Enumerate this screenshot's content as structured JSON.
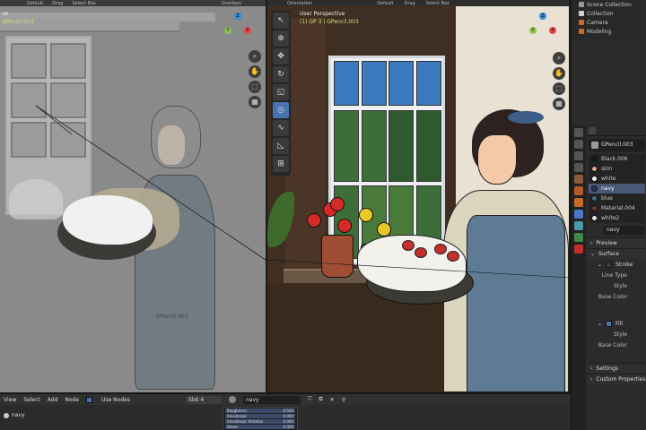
{
  "left_viewport": {
    "header_items": [
      "Default",
      "Drag",
      "Select Box",
      "Overlays"
    ],
    "title": "ve",
    "subtitle": "GPencil.003",
    "object_label": "GPencil.003"
  },
  "right_viewport": {
    "header_items": [
      "Orientation",
      "Default",
      "Drag",
      "Select Box"
    ],
    "title": "User Perspective",
    "subtitle": "(1) GP 3 | GPencil.003"
  },
  "gizmo": {
    "x": "X",
    "y": "Y",
    "z": "Z"
  },
  "outliner": {
    "items": [
      {
        "label": "Scene Collection",
        "color": "#9a9a9a"
      },
      {
        "label": "Collection",
        "color": "#d0d0d0"
      },
      {
        "label": "Camera",
        "color": "#c46a2a"
      },
      {
        "label": "Modeling",
        "color": "#c46a2a"
      }
    ]
  },
  "properties": {
    "object_name": "GPencil.003",
    "materials": [
      {
        "label": "Black.006",
        "color": "#1b1b1b"
      },
      {
        "label": "skin",
        "color": "#e6a77e"
      },
      {
        "label": "white",
        "color": "#f2f2f2"
      },
      {
        "label": "navy",
        "color": "#2b3a5a",
        "selected": true
      },
      {
        "label": "blue",
        "color": "#4a6a8a"
      },
      {
        "label": "Material.004",
        "color": "#6b3a2a"
      },
      {
        "label": "white2",
        "color": "#e8e8e8"
      }
    ],
    "active_material": "navy",
    "sections": {
      "preview": "Preview",
      "surface": "Surface",
      "stroke": "Stroke",
      "line_type": "Line Type",
      "style": "Style",
      "base_color": "Base Color",
      "fill": "Fill",
      "fill_style": "Style",
      "fill_base_color": "Base Color",
      "settings": "Settings",
      "custom_properties": "Custom Properties"
    }
  },
  "bottom_editor": {
    "menu": [
      "View",
      "Select",
      "Add",
      "Node"
    ],
    "use_nodes": "Use Nodes",
    "slot": "Slot 4",
    "material": "navy",
    "node_material": "navy",
    "node_rows": [
      {
        "label": "Roughness",
        "value": "0.500"
      },
      {
        "label": "Anisotropic",
        "value": "0.000"
      },
      {
        "label": "Anisotropic Rotation",
        "value": "0.000"
      },
      {
        "label": "Sheen",
        "value": "0.000"
      }
    ]
  },
  "colors": {
    "accent": "#4772b3",
    "selected_row": "#4a5878",
    "subtitle": "#d6e07a"
  }
}
